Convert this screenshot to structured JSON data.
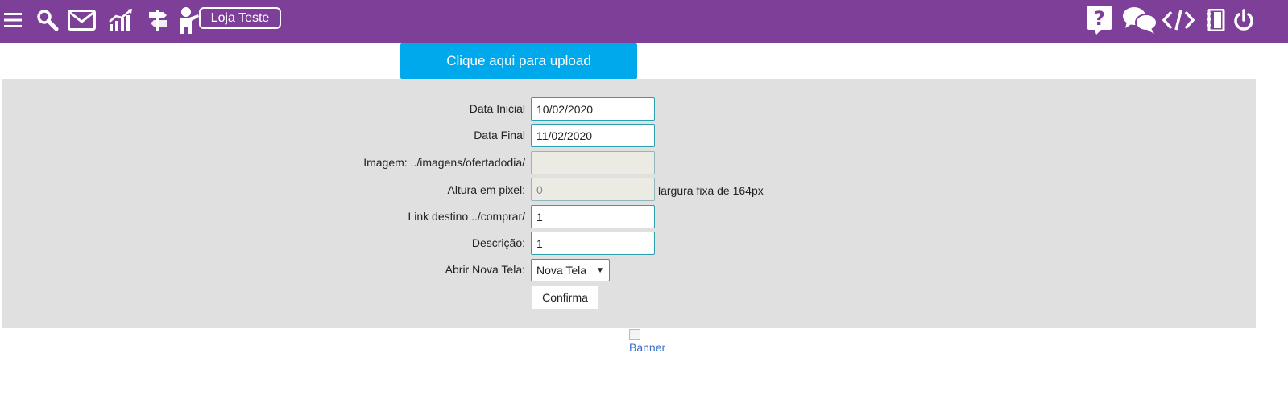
{
  "topbar": {
    "color": "#7e3f98",
    "left_icons": [
      "menu-icon",
      "search-icon",
      "mail-icon",
      "chart-icon",
      "signpost-icon",
      "teacher-icon"
    ],
    "store_label": "Loja Teste",
    "right_icons": [
      "help-icon",
      "chat-icon",
      "code-icon",
      "notebook-icon",
      "power-icon"
    ]
  },
  "upload": {
    "label": "Clique aqui para upload",
    "color": "#00a9ec"
  },
  "form": {
    "data_inicial": {
      "label": "Data Inicial",
      "value": "10/02/2020"
    },
    "data_final": {
      "label": "Data Final",
      "value": "11/02/2020"
    },
    "imagem": {
      "label": "Imagem: ../imagens/ofertadodia/",
      "value": ""
    },
    "altura": {
      "label": "Altura em pixel:",
      "value": "0",
      "hint": "largura fixa de 164px"
    },
    "link": {
      "label": "Link destino ../comprar/",
      "value": "1"
    },
    "descricao": {
      "label": "Descrição:",
      "value": "1"
    },
    "nova_tela": {
      "label": "Abrir Nova Tela:",
      "selected": "Nova Tela"
    },
    "confirm_label": "Confirma"
  },
  "banner": {
    "alt": "Banner"
  }
}
